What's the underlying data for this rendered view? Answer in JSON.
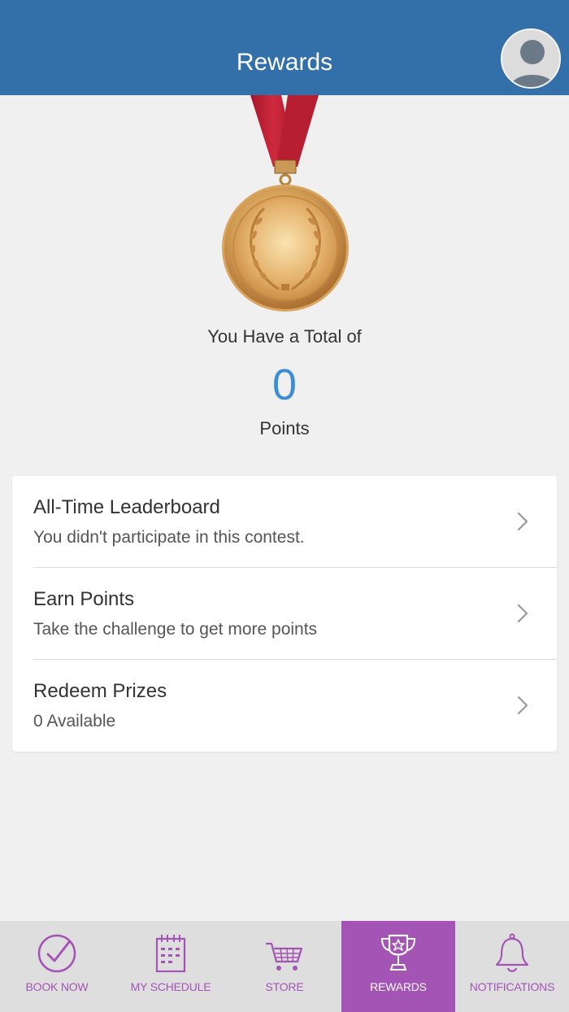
{
  "header": {
    "title": "Rewards",
    "avatar_icon": "user-avatar-icon"
  },
  "summary": {
    "total_label": "You Have a Total of",
    "points_value": "0",
    "points_unit": "Points"
  },
  "menu": [
    {
      "title": "All-Time Leaderboard",
      "subtitle": "You didn't participate in this contest."
    },
    {
      "title": "Earn Points",
      "subtitle": "Take the challenge to get more points"
    },
    {
      "title": "Redeem Prizes",
      "subtitle": "0 Available"
    }
  ],
  "bottom_nav": [
    {
      "label": "BOOK NOW",
      "icon": "check-circle-icon",
      "active": false
    },
    {
      "label": "MY SCHEDULE",
      "icon": "calendar-icon",
      "active": false
    },
    {
      "label": "STORE",
      "icon": "cart-icon",
      "active": false
    },
    {
      "label": "REWARDS",
      "icon": "trophy-icon",
      "active": true
    },
    {
      "label": "NOTIFICATIONS",
      "icon": "bell-icon",
      "active": false
    }
  ],
  "colors": {
    "header": "#336fa8",
    "accent": "#a354b5",
    "points": "#3e8ed6",
    "background": "#f0f0f0"
  }
}
